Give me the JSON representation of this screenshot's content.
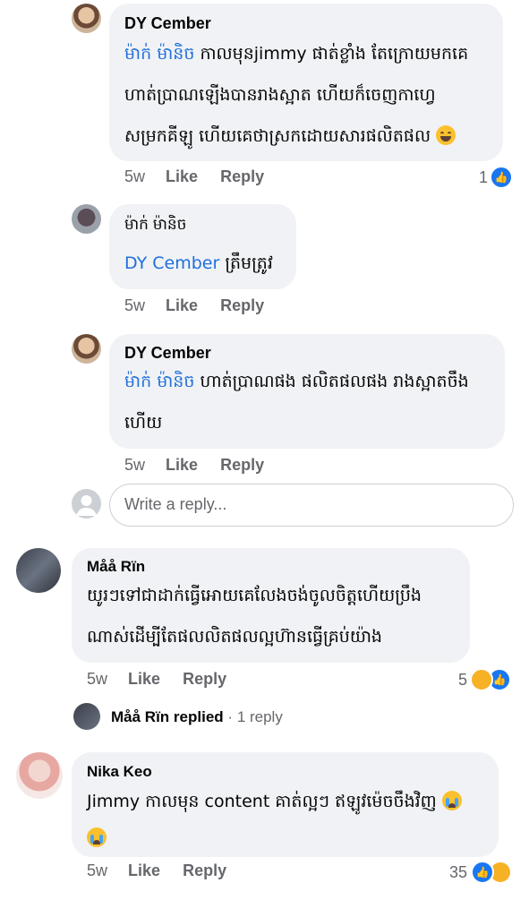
{
  "comments": [
    {
      "name": "DY Cember",
      "mention": "ម៉ាក់ ម៉ានិច",
      "lines": [
        "កាលមុនjimmy ផាត់ខ្លាំង តែក្រោយមកគេ",
        "ហាត់ប្រាណឡើងបានរាងស្អាត ហើយក៏ចេញកាហ្វេ",
        "សម្រកគីឡូ ហើយគេថាស្រកដោយសារផលិតផល"
      ],
      "time": "5w",
      "like": "Like",
      "reply": "Reply",
      "reactions": "1"
    },
    {
      "name": "ម៉ាក់ ម៉ានិច",
      "mention": "DY Cember",
      "lines": [
        "ត្រឹមត្រូវ"
      ],
      "time": "5w",
      "like": "Like",
      "reply": "Reply"
    },
    {
      "name": "DY Cember",
      "mention": "ម៉ាក់ ម៉ានិច",
      "lines": [
        "ហាត់ប្រាណផង ផលិតផលផង រាងស្អាតចឹង",
        "ហើយ"
      ],
      "time": "5w",
      "like": "Like",
      "reply": "Reply"
    },
    {
      "name": "Måå Rïn",
      "lines": [
        "យូរៗទៅជាដាក់ធ្វើអោយគេលែងចង់ចូលចិត្តហើយប្រឹង",
        "ណាស់ដើម្បីតែផលលិតផលល្អហ៊ានធ្វើគ្រប់យ៉ាង"
      ],
      "time": "5w",
      "like": "Like",
      "reply": "Reply",
      "reactions": "5"
    },
    {
      "name": "Nika Keo",
      "lines": [
        "Jimmy កាលមុន content គាត់ល្អៗ ឥឡូវម៉េចចឹងវិញ"
      ],
      "time": "5w",
      "like": "Like",
      "reply": "Reply",
      "reactions": "35"
    }
  ],
  "write_reply": {
    "placeholder": "Write a reply..."
  },
  "replied_row": {
    "name": "Måå Rïn",
    "text": "replied",
    "dot": "·",
    "count": "1 reply"
  },
  "colors": {
    "bubble": "#f0f2f5",
    "mention": "#216fdb",
    "meta": "#65676b",
    "like": "#1877f2"
  },
  "icons": [
    "like-reaction-icon",
    "haha-reaction-icon",
    "sad-reaction-icon",
    "grin-emoji-icon",
    "cry-emoji-icon"
  ]
}
